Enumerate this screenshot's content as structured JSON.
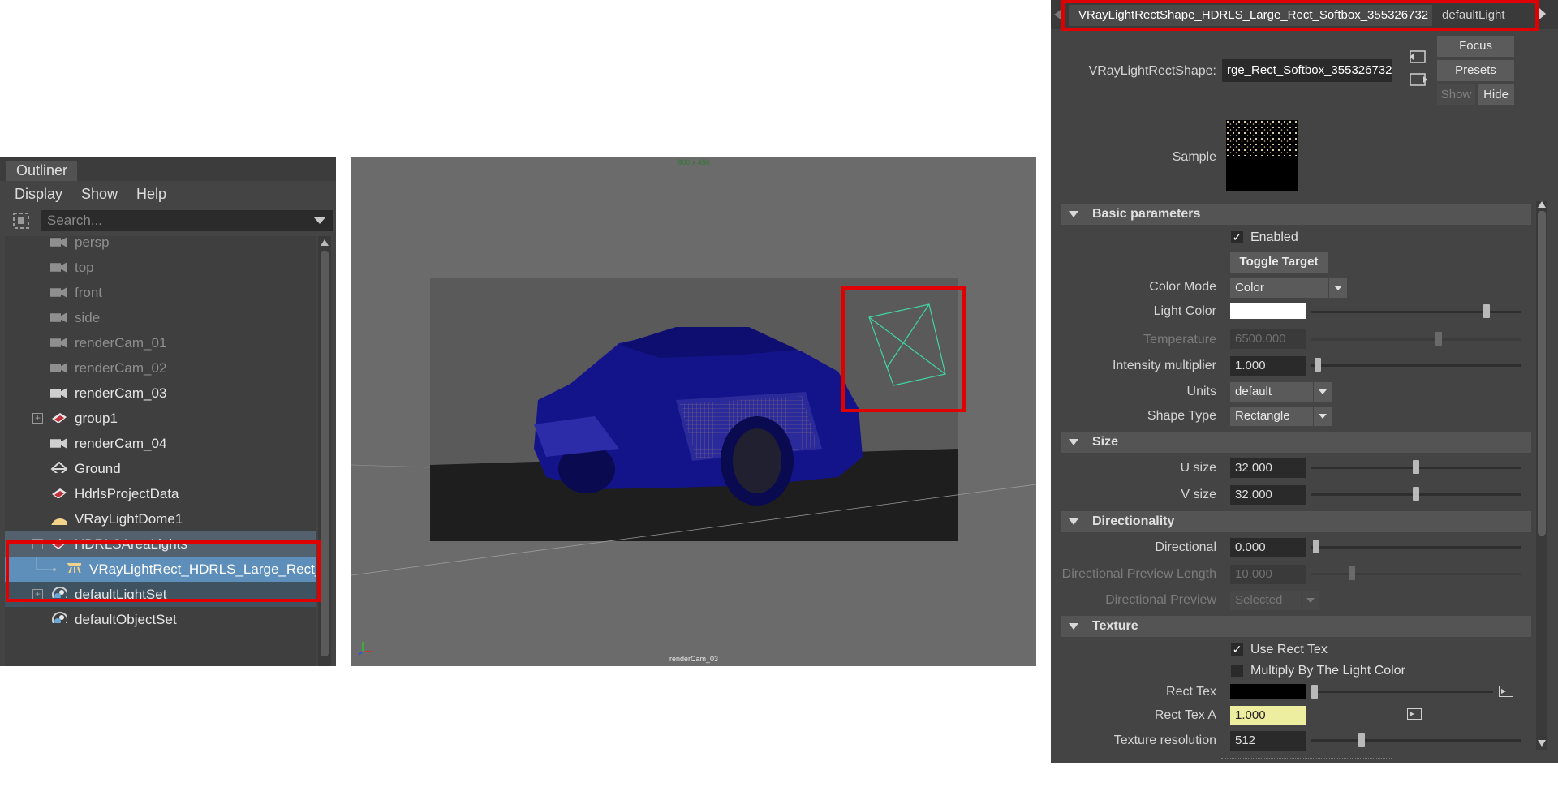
{
  "outliner": {
    "tab": "Outliner",
    "menus": [
      "Display",
      "Show",
      "Help"
    ],
    "search_placeholder": "Search...",
    "items": [
      {
        "label": "persp",
        "icon": "camera-icon",
        "state": "dim"
      },
      {
        "label": "top",
        "icon": "camera-icon",
        "state": "dim"
      },
      {
        "label": "front",
        "icon": "camera-icon",
        "state": "dim"
      },
      {
        "label": "side",
        "icon": "camera-icon",
        "state": "dim"
      },
      {
        "label": "renderCam_01",
        "icon": "camera-icon",
        "state": "dim"
      },
      {
        "label": "renderCam_02",
        "icon": "camera-icon",
        "state": "dim"
      },
      {
        "label": "renderCam_03",
        "icon": "camera-icon",
        "state": "normal"
      },
      {
        "label": "group1",
        "icon": "group-icon",
        "state": "normal",
        "expandable": true
      },
      {
        "label": "renderCam_04",
        "icon": "camera-icon",
        "state": "normal"
      },
      {
        "label": "Ground",
        "icon": "mesh-icon",
        "state": "normal"
      },
      {
        "label": "HdrlsProjectData",
        "icon": "group-icon",
        "state": "normal"
      },
      {
        "label": "VRayLightDome1",
        "icon": "dome-light-icon",
        "state": "normal"
      },
      {
        "label": "HDRLSAreaLights",
        "icon": "group-icon",
        "state": "selected-parent",
        "expandable": true
      },
      {
        "label": "VRayLightRect_HDRLS_Large_Rect_",
        "icon": "rect-light-icon",
        "state": "selected"
      },
      {
        "label": "defaultLightSet",
        "icon": "set-icon",
        "state": "selected-dim",
        "expandable": true
      },
      {
        "label": "defaultObjectSet",
        "icon": "set-icon",
        "state": "normal"
      }
    ]
  },
  "viewport": {
    "resolution": "900 x 450",
    "camera": "renderCam_03"
  },
  "attribute_editor": {
    "tabs": [
      "VRayLightRectShape_HDRLS_Large_Rect_Softbox_355326732",
      "defaultLight"
    ],
    "node_type_label": "VRayLightRectShape:",
    "node_name": "rge_Rect_Softbox_355326732",
    "focus_button": "Focus",
    "presets_button": "Presets",
    "show_button": "Show",
    "hide_button": "Hide",
    "sample_label": "Sample",
    "sections": {
      "basic": "Basic parameters",
      "size": "Size",
      "directionality": "Directionality",
      "texture": "Texture"
    },
    "enabled_label": "Enabled",
    "enabled": true,
    "toggle_target": "Toggle Target",
    "color_mode_label": "Color Mode",
    "color_mode": "Color",
    "light_color_label": "Light Color",
    "light_color": "#ffffff",
    "light_color_level": 0.85,
    "temperature_label": "Temperature",
    "temperature": "6500.000",
    "temperature_level": 0.6,
    "intensity_label": "Intensity multiplier",
    "intensity": "1.000",
    "intensity_level": 0.02,
    "units_label": "Units",
    "units": "default",
    "shape_type_label": "Shape Type",
    "shape_type": "Rectangle",
    "u_size_label": "U size",
    "u_size": "32.000",
    "u_size_level": 0.5,
    "v_size_label": "V size",
    "v_size": "32.000",
    "v_size_level": 0.5,
    "directional_label": "Directional",
    "directional": "0.000",
    "directional_level": 0.0,
    "dir_preview_length_label": "Directional Preview Length",
    "dir_preview_length": "10.000",
    "dir_preview_length_level": 0.2,
    "dir_preview_label": "Directional Preview",
    "dir_preview": "Selected",
    "use_rect_tex_label": "Use Rect Tex",
    "use_rect_tex": true,
    "multiply_label": "Multiply By The Light Color",
    "multiply": false,
    "rect_tex_label": "Rect Tex",
    "rect_tex_a_label": "Rect Tex A",
    "rect_tex_a": "1.000",
    "tex_res_label": "Texture resolution",
    "tex_res": "512",
    "tex_res_level": 0.24
  },
  "colors": {
    "highlight_red": "#e00000",
    "selected_row": "#5d8fba",
    "wireframe": "#1a1a8c",
    "light_gizmo": "#3fd6a0"
  }
}
